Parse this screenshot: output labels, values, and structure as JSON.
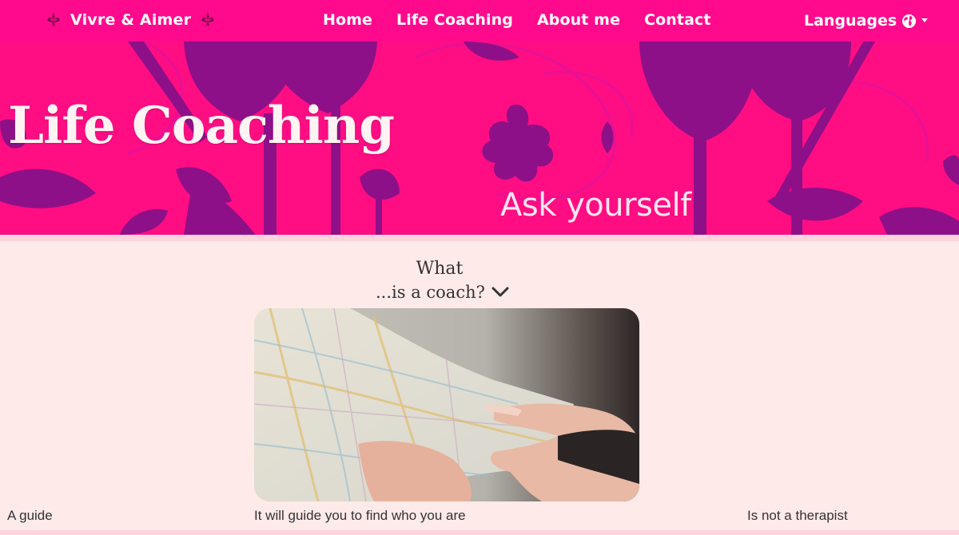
{
  "navbar": {
    "brand": "Vivre & Aimer",
    "links": [
      {
        "label": "Home"
      },
      {
        "label": "Life Coaching"
      },
      {
        "label": "About me"
      },
      {
        "label": "Contact"
      }
    ],
    "languages_label": "Languages",
    "brand_icon": "fleur-de-lis-icon",
    "language_icon": "globe-icon"
  },
  "hero": {
    "title": "Life Coaching",
    "subtitle": "Ask yourself"
  },
  "section": {
    "heading_line1": "What",
    "heading_line2": "...is a coach?",
    "expand_icon": "chevron-down-icon"
  },
  "captions": {
    "left": "A guide",
    "middle": "It will guide you to find who you are",
    "right": "Is not a therapist"
  },
  "colors": {
    "navbar": "#ff0a8c",
    "hero": "#ff0d83",
    "hero_silhouettes": "#8e1088",
    "page_background": "#ffeaea",
    "text": "#333333"
  }
}
